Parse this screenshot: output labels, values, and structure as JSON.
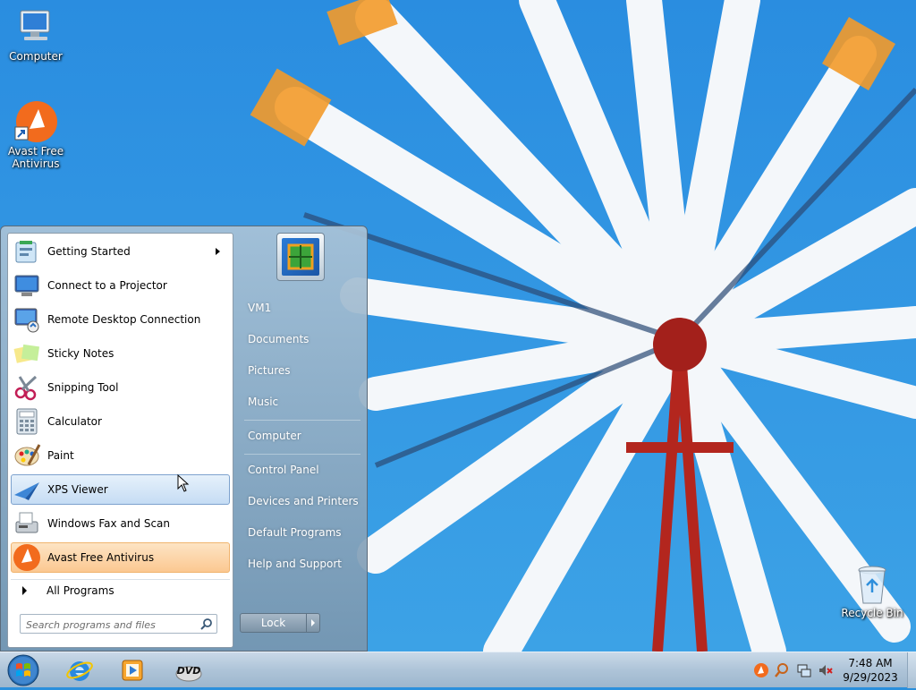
{
  "desktop": {
    "icons": [
      {
        "label": "Computer",
        "icon": "computer-icon"
      },
      {
        "label": "Avast Free Antivirus",
        "icon": "avast-icon"
      },
      {
        "label": "Recycle Bin",
        "icon": "recycle-bin-icon"
      }
    ]
  },
  "start_menu": {
    "programs": [
      {
        "label": "Getting Started",
        "icon": "getting-started-icon",
        "has_submenu": true
      },
      {
        "label": "Connect to a Projector",
        "icon": "projector-icon"
      },
      {
        "label": "Remote Desktop Connection",
        "icon": "remote-desktop-icon"
      },
      {
        "label": "Sticky Notes",
        "icon": "sticky-notes-icon"
      },
      {
        "label": "Snipping Tool",
        "icon": "snipping-tool-icon"
      },
      {
        "label": "Calculator",
        "icon": "calculator-icon"
      },
      {
        "label": "Paint",
        "icon": "paint-icon"
      },
      {
        "label": "XPS Viewer",
        "icon": "xps-viewer-icon",
        "state": "hover"
      },
      {
        "label": "Windows Fax and Scan",
        "icon": "fax-scan-icon"
      },
      {
        "label": "Avast Free Antivirus",
        "icon": "avast-icon",
        "state": "newly-installed"
      }
    ],
    "all_programs_label": "All Programs",
    "search_placeholder": "Search programs and files",
    "right_links": [
      {
        "label": "VM1"
      },
      {
        "label": "Documents"
      },
      {
        "label": "Pictures"
      },
      {
        "label": "Music"
      },
      {
        "label": "Computer"
      },
      {
        "label": "Control Panel"
      },
      {
        "label": "Devices and Printers"
      },
      {
        "label": "Default Programs"
      },
      {
        "label": "Help and Support"
      }
    ],
    "power_button_label": "Lock"
  },
  "taskbar": {
    "pinned": [
      {
        "name": "internet-explorer-icon"
      },
      {
        "name": "media-player-icon"
      },
      {
        "name": "dvd-maker-icon"
      }
    ],
    "tray_icons": [
      "avast-tray-icon",
      "search-tray-icon",
      "network-tray-icon",
      "volume-muted-icon"
    ],
    "clock": {
      "time": "7:48 AM",
      "date": "9/29/2023"
    }
  },
  "colors": {
    "accent": "#2d90da",
    "avast_orange": "#f26b1d",
    "hover_blue": "#c5dcf4",
    "new_program_orange": "#fbc891"
  }
}
